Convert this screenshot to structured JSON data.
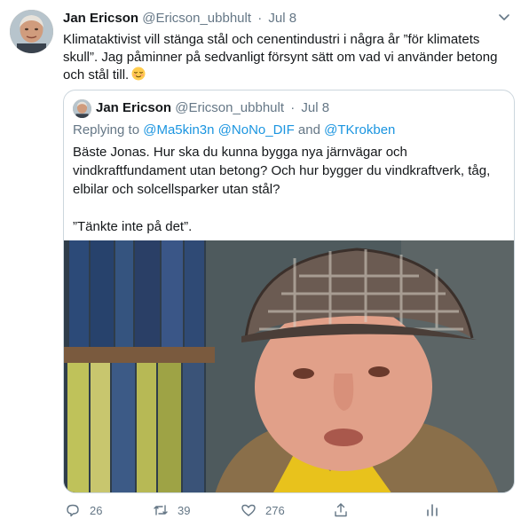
{
  "tweet": {
    "author_name": "Jan Ericson",
    "author_handle": "@Ericson_ubbhult",
    "separator": "·",
    "date": "Jul 8",
    "text": "Klimataktivist vill stänga stål och cenentindustri i några år ”för klimatets skull”. Jag påminner på sedvanligt försynt sätt om vad vi använder betong och stål till.",
    "emoji_icon": "relieved-face-icon"
  },
  "quoted": {
    "author_name": "Jan Ericson",
    "author_handle": "@Ericson_ubbhult",
    "separator": "·",
    "date": "Jul 8",
    "reply_prefix": "Replying to ",
    "mention_1": "@Ma5kin3n",
    "mention_2": "@NoNo_DIF",
    "reply_and": " and ",
    "mention_3": "@TKrokben",
    "paragraph_1": "Bäste Jonas. Hur ska du kunna bygga nya järnvägar och vindkraftfundament utan betong? Och hur bygger du vindkraftverk, tåg, elbilar och solcellsparker utan stål?",
    "paragraph_2": "”Tänkte inte på det”."
  },
  "actions": {
    "reply_count": "26",
    "retweet_count": "39",
    "like_count": "276"
  },
  "colors": {
    "link": "#1b95e0",
    "muted": "#657786",
    "border": "#ccd6dd"
  }
}
